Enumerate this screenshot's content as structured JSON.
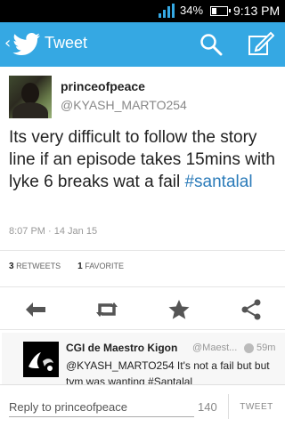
{
  "status_bar": {
    "battery": "34%",
    "time": "9:13 PM",
    "battery_level": 0.34
  },
  "action_bar": {
    "title": "Tweet",
    "accent": "#35a8e3"
  },
  "tweet": {
    "name": "princeofpeace",
    "handle": "@KYASH_MARTO254",
    "text": "Its very difficult to follow the story line if an episode takes 15mins with lyke 6 breaks wat a fail ",
    "hashtag": "#santalal",
    "timestamp": "8:07 PM · 14 Jan 15",
    "retweets_count": "3",
    "retweets_label": "RETWEETS",
    "favorites_count": "1",
    "favorites_label": "FAVORITE"
  },
  "icons": {
    "reply": "reply-icon",
    "retweet": "retweet-icon",
    "favorite": "star-icon",
    "share": "share-icon"
  },
  "reply": {
    "name": "CGI de Maestro Kigon",
    "handle": "@Maest...",
    "time": "59m",
    "text": "@KYASH_MARTO254 It's not a fail but but tym was wanting #Santalal"
  },
  "compose": {
    "placeholder": "Reply to princeofpeace",
    "char_count": "140",
    "tweet_button": "TWEET"
  }
}
